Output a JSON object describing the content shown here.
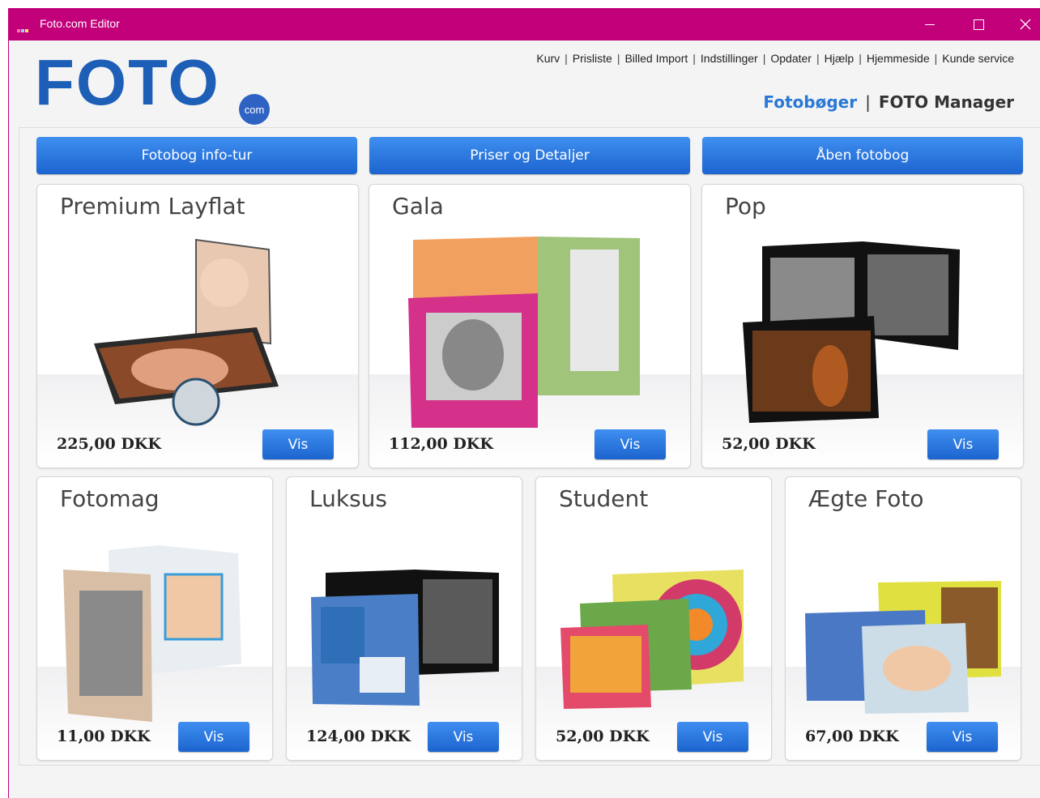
{
  "window": {
    "title": "Foto.com Editor"
  },
  "logo": {
    "word": "FOTO",
    "badge": "com"
  },
  "top_links": [
    "Kurv",
    "Prisliste",
    "Billed Import",
    "Indstillinger",
    "Opdater",
    "Hjælp",
    "Hjemmeside",
    "Kunde service"
  ],
  "nav": {
    "active": "Fotobøger",
    "separator": "|",
    "other": "FOTO Manager"
  },
  "buttons": {
    "info_tour": "Fotobog info-tur",
    "prices": "Priser og Detaljer",
    "open": "Åben fotobog"
  },
  "products": [
    {
      "name": "Premium Layflat",
      "price": "225,00 DKK",
      "action": "Vis"
    },
    {
      "name": "Gala",
      "price": "112,00 DKK",
      "action": "Vis"
    },
    {
      "name": "Pop",
      "price": "52,00 DKK",
      "action": "Vis"
    },
    {
      "name": "Fotomag",
      "price": "11,00 DKK",
      "action": "Vis"
    },
    {
      "name": "Luksus",
      "price": "124,00 DKK",
      "action": "Vis"
    },
    {
      "name": "Student",
      "price": "52,00 DKK",
      "action": "Vis"
    },
    {
      "name": "Ægte Foto",
      "price": "67,00 DKK",
      "action": "Vis"
    }
  ],
  "colors": {
    "titlebar": "#c2007a",
    "accent": "#1c64cf",
    "logo": "#1d5fb6",
    "active_nav": "#2a78d6"
  }
}
